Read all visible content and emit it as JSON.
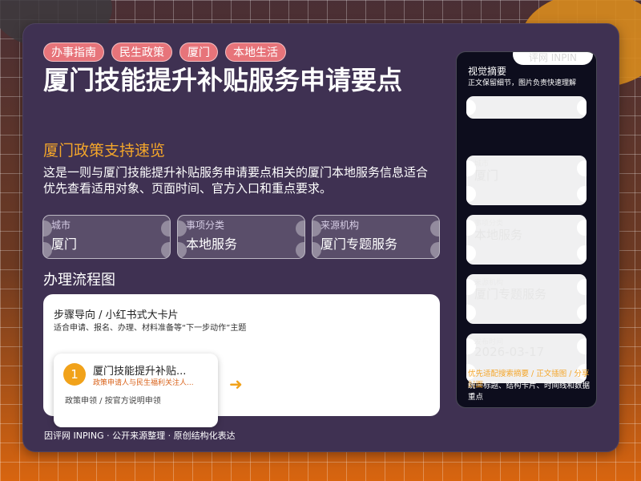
{
  "tags": [
    "办事指南",
    "民生政策",
    "厦门",
    "本地生活"
  ],
  "title": "厦门技能提升补贴服务申请要点",
  "subtitle": "厦门政策支持速览",
  "description": "这是一则与厦门技能提升补贴服务申请要点相关的厦门本地服务信息适合优先查看适用对象、页面时间、官方入口和重点要求。",
  "info_boxes": [
    {
      "label": "城市",
      "value": "厦门"
    },
    {
      "label": "事项分类",
      "value": "本地服务"
    },
    {
      "label": "来源机构",
      "value": "厦门专题服务"
    }
  ],
  "flow": {
    "section_title": "办理流程图",
    "heading": "步骤导向 / 小红书式大卡片",
    "subheading": "适合申请、报名、办理、材料准备等“下一步动作”主题",
    "step": {
      "number": "1",
      "title": "厦门技能提升补贴...",
      "subtitle": "政策申请人与民生福利关注人...",
      "meta": "政策申领 / 按官方说明申领"
    },
    "arrow": "➜"
  },
  "footer": "因评网 INPING · 公开来源整理 · 原创结构化表达",
  "phone": {
    "badge": "评网 INPIN",
    "title": "视觉摘要",
    "subtitle": "正文保留细节，图片负责快速理解",
    "boxes": [
      {
        "label": "",
        "value": ""
      },
      {
        "label": "城市",
        "value": "厦门"
      },
      {
        "label": "事项分类",
        "value": "本地服务"
      },
      {
        "label": "来源机构",
        "value": "厦门专题服务"
      },
      {
        "label": "发布时间",
        "value": "2026-03-17"
      }
    ],
    "footer_highlight": "优先适配搜索摘要 / 正文插图 / 分享封面",
    "footer_text": "统一标题、结构卡片、时间线和数据重点"
  }
}
